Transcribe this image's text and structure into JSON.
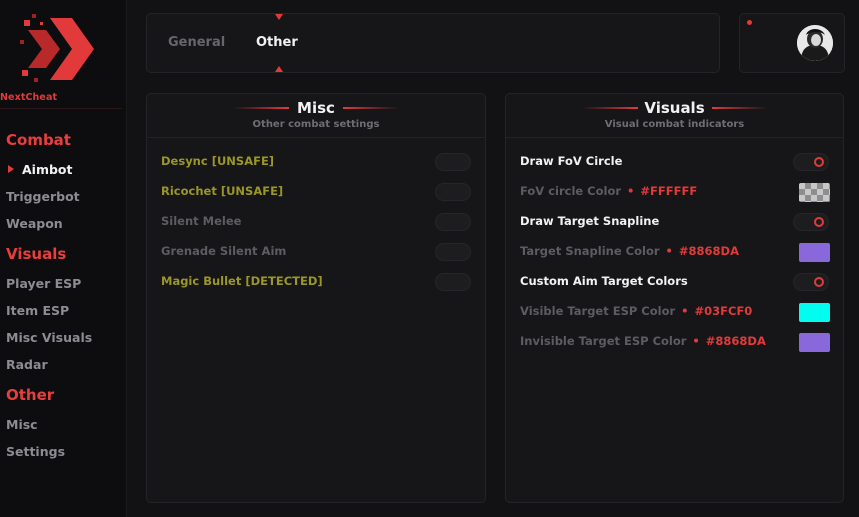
{
  "brand": {
    "name": "NextCheat",
    "accent": "#e23a3a"
  },
  "sidebar": {
    "sections": [
      {
        "title": "Combat",
        "items": [
          "Aimbot",
          "Triggerbot",
          "Weapon"
        ]
      },
      {
        "title": "Visuals",
        "items": [
          "Player ESP",
          "Item ESP",
          "Misc Visuals",
          "Radar"
        ]
      },
      {
        "title": "Other",
        "items": [
          "Misc",
          "Settings"
        ]
      }
    ],
    "active_item": "Aimbot"
  },
  "tabs": {
    "items": [
      "General",
      "Other"
    ],
    "active": "Other"
  },
  "user": {
    "avatar_icon": "user-avatar",
    "status_color": "#e23a3a"
  },
  "misc": {
    "title": "Misc",
    "subtitle": "Other combat settings",
    "options": [
      {
        "label": "Desync [UNSAFE]",
        "enabled": false,
        "style": "warning"
      },
      {
        "label": "Ricochet [UNSAFE]",
        "enabled": false,
        "style": "warning"
      },
      {
        "label": "Silent Melee",
        "enabled": false,
        "style": "disabled"
      },
      {
        "label": "Grenade Silent Aim",
        "enabled": false,
        "style": "disabled"
      },
      {
        "label": "Magic Bullet [DETECTED]",
        "enabled": false,
        "style": "warning"
      }
    ]
  },
  "visuals": {
    "title": "Visuals",
    "subtitle": "Visual combat indicators",
    "options": [
      {
        "label": "Draw FoV Circle",
        "kind": "toggle",
        "enabled": true
      },
      {
        "label": "FoV circle Color",
        "kind": "color",
        "value": "#FFFFFF"
      },
      {
        "label": "Draw Target Snapline",
        "kind": "toggle",
        "enabled": true
      },
      {
        "label": "Target Snapline Color",
        "kind": "color",
        "value": "#8868DA"
      },
      {
        "label": "Custom Aim Target Colors",
        "kind": "toggle",
        "enabled": true
      },
      {
        "label": "Visible Target ESP Color",
        "kind": "color",
        "value": "#03FCF0"
      },
      {
        "label": "Invisible Target ESP Color",
        "kind": "color",
        "value": "#8868DA"
      }
    ]
  }
}
